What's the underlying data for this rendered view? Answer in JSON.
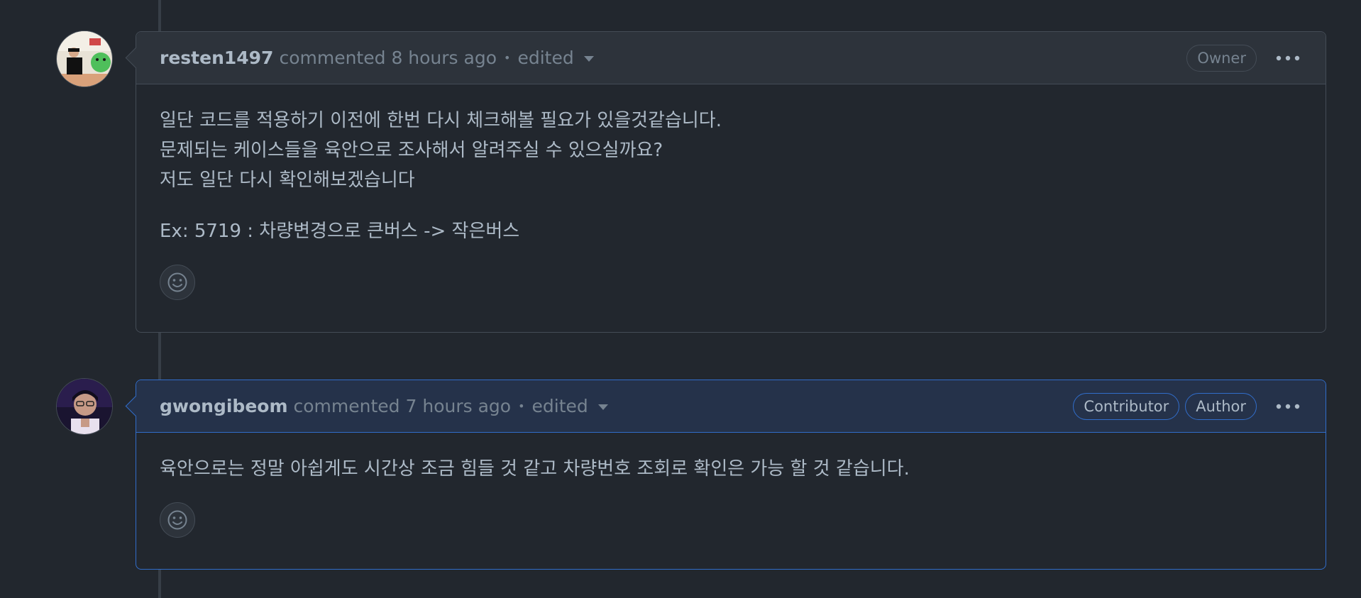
{
  "comments": [
    {
      "author": "resten1497",
      "action": "commented",
      "time": "8 hours ago",
      "separator": "•",
      "edited": "edited",
      "badges": [
        "Owner"
      ],
      "more_icon": "kebab-horizontal-icon",
      "reaction_icon": "smiley-icon",
      "paragraphs": [
        "일단 코드를 적용하기 이전에 한번 다시 체크해볼 필요가 있을것같습니다.",
        "문제되는 케이스들을 육안으로 조사해서 알려주실 수 있으실까요?",
        "저도 일단 다시 확인해보겠습니다",
        "Ex: 5719 : 차량변경으로 큰버스 -> 작은버스"
      ]
    },
    {
      "author": "gwongibeom",
      "action": "commented",
      "time": "7 hours ago",
      "separator": "•",
      "edited": "edited",
      "badges": [
        "Contributor",
        "Author"
      ],
      "more_icon": "kebab-horizontal-icon",
      "reaction_icon": "smiley-icon",
      "paragraphs": [
        "육안으로는 정말 아쉽게도 시간상 조금 힘들 것 같고 차량번호 조회로 확인은 가능 할 것 같습니다."
      ]
    }
  ],
  "colors": {
    "background": "#22272e",
    "header": "#2d333b",
    "highlight_border": "#316dca",
    "text": "#adbac7",
    "muted": "#768390"
  }
}
